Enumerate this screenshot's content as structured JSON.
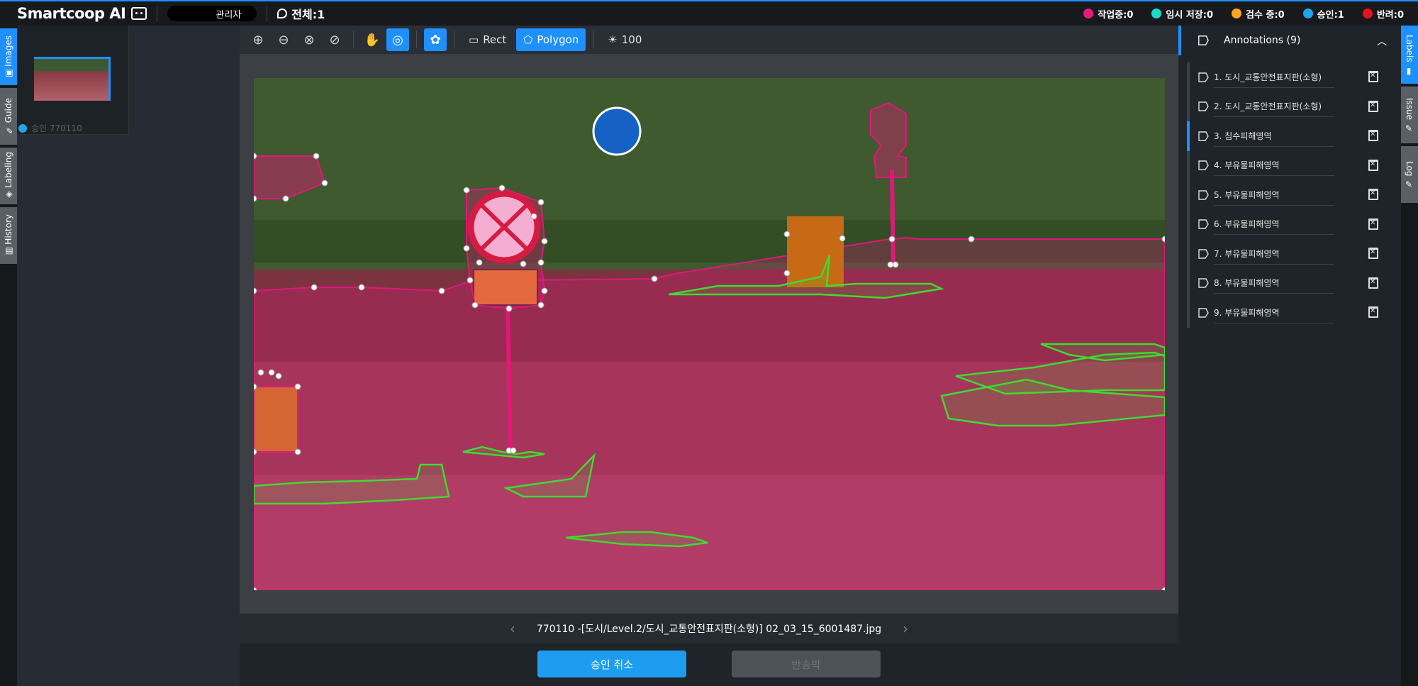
{
  "app": {
    "brand": "Smartcoop AI",
    "role": "관리자",
    "total": "전체:1"
  },
  "statuses": [
    {
      "label": "작업중:0",
      "color": "#e7187f"
    },
    {
      "label": "임시 저장:0",
      "color": "#19d9c8"
    },
    {
      "label": "검수 중:0",
      "color": "#f5a623"
    },
    {
      "label": "승인:1",
      "color": "#1ea7e8"
    },
    {
      "label": "반려:0",
      "color": "#e8141c"
    }
  ],
  "left_tabs": [
    {
      "label": "Images",
      "icon": "image-icon"
    },
    {
      "label": "Guide",
      "icon": "pencil-icon"
    },
    {
      "label": "Labeling",
      "icon": "tag-icon"
    },
    {
      "label": "History",
      "icon": "history-icon"
    }
  ],
  "thumbnail": {
    "caption": "승인 770110"
  },
  "toolbar": {
    "rect_label": "Rect",
    "polygon_label": "Polygon",
    "brightness_value": "100"
  },
  "image": {
    "filename": "770110 -[도시/Level.2/도시_교통안전표지판(소형)] 02_03_15_6001487.jpg"
  },
  "actions": {
    "cancel_approval": "승인 취소",
    "return": "반송박"
  },
  "annotations": {
    "header": "Annotations (9)",
    "items": [
      "1. 도시_교통안전표지판(소형)",
      "2. 도시_교통안전표지판(소형)",
      "3. 침수피해영역",
      "4. 부유물피해영역",
      "5. 부유물피해영역",
      "6. 부유물피해영역",
      "7. 부유물피해영역",
      "8. 부유물피해영역",
      "9. 부유물피해영역"
    ]
  },
  "right_tabs": [
    {
      "label": "Labels",
      "icon": "label-icon"
    },
    {
      "label": "Issue",
      "icon": "pencil-icon"
    },
    {
      "label": "Log",
      "icon": "pencil-icon"
    }
  ],
  "colors": {
    "accent": "#1e90ff",
    "flood_polygon": "#e0187a",
    "debris_polygon": "#3ddc2f"
  }
}
